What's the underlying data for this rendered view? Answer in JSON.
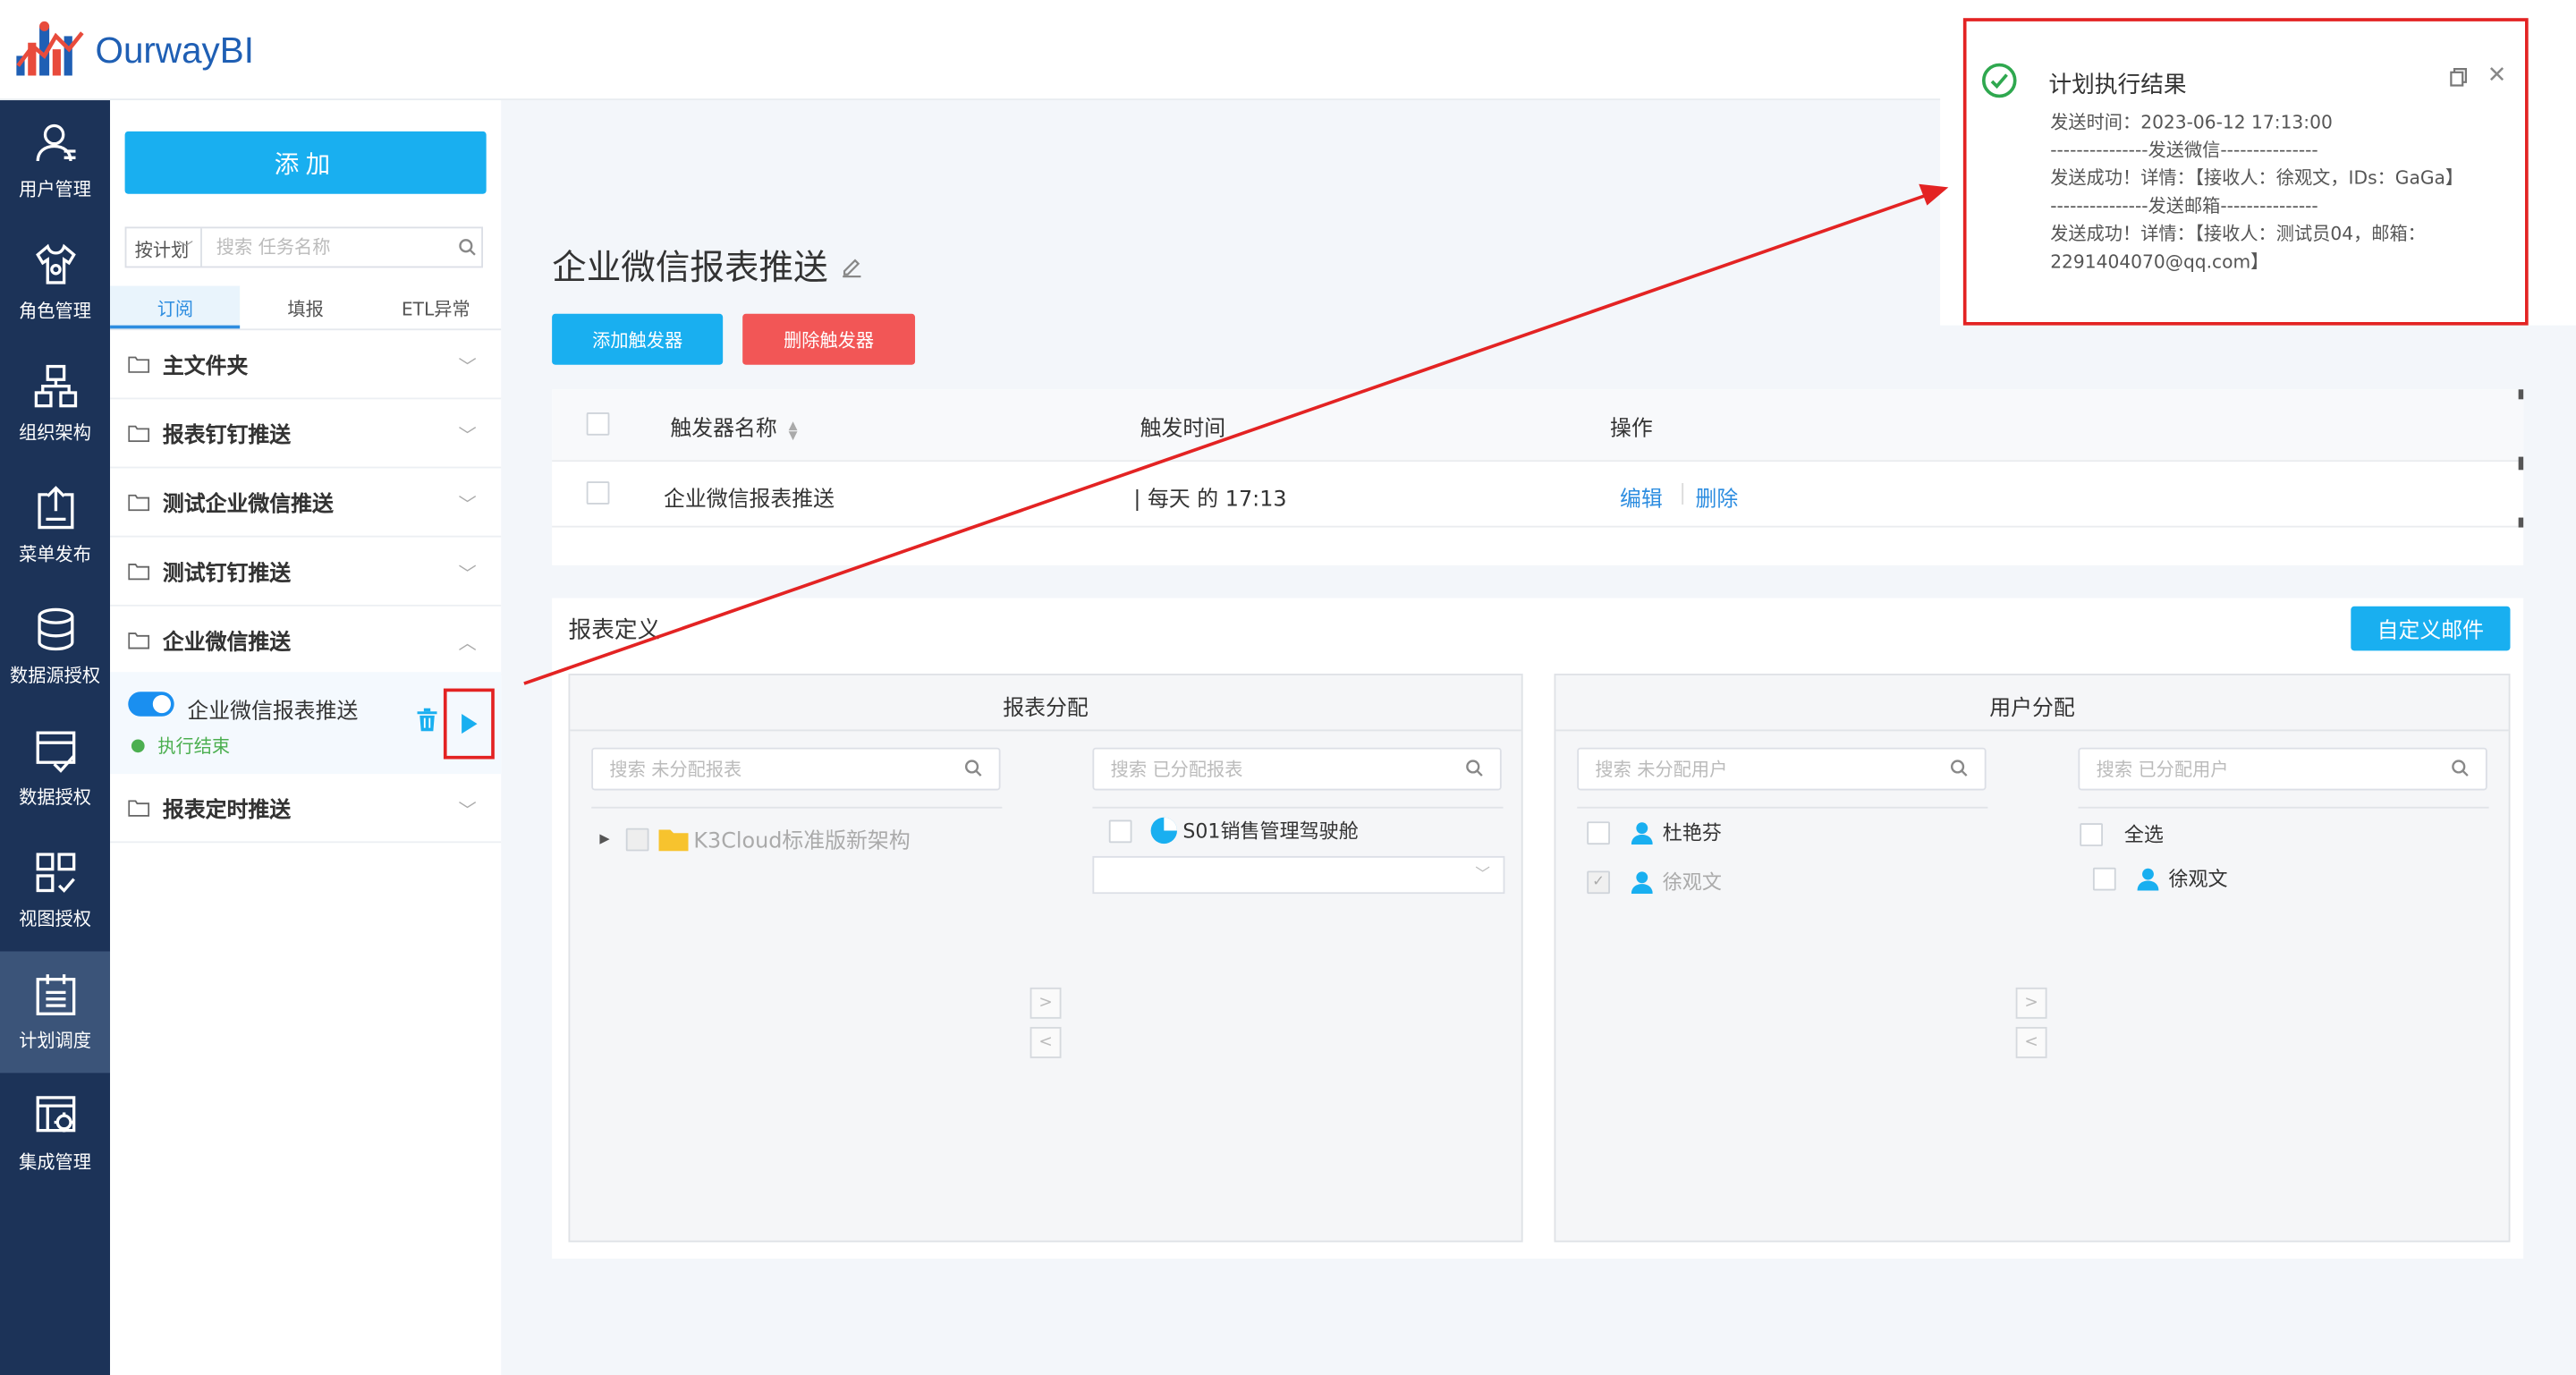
{
  "app": {
    "logo_text": "OurwayBI"
  },
  "nav": {
    "items": [
      {
        "label": "用户管理",
        "icon": "user-icon"
      },
      {
        "label": "角色管理",
        "icon": "role-shirt-icon"
      },
      {
        "label": "组织架构",
        "icon": "org-chart-icon"
      },
      {
        "label": "菜单发布",
        "icon": "publish-icon"
      },
      {
        "label": "数据源授权",
        "icon": "database-icon"
      },
      {
        "label": "数据授权",
        "icon": "data-auth-icon"
      },
      {
        "label": "视图授权",
        "icon": "view-grid-icon"
      },
      {
        "label": "计划调度",
        "icon": "calendar-icon",
        "active": true
      },
      {
        "label": "集成管理",
        "icon": "integration-icon"
      }
    ]
  },
  "sidebar": {
    "add_label": "添加",
    "filter_select": "按计划",
    "search_placeholder": "搜索 任务名称",
    "tabs": [
      "订阅",
      "填报",
      "ETL异常"
    ],
    "active_tab": "订阅",
    "folders": [
      {
        "label": "主文件夹",
        "expanded": false
      },
      {
        "label": "报表钉钉推送",
        "expanded": false
      },
      {
        "label": "测试企业微信推送",
        "expanded": false
      },
      {
        "label": "测试钉钉推送",
        "expanded": false
      },
      {
        "label": "企业微信推送",
        "expanded": true
      },
      {
        "label": "报表定时推送",
        "expanded": false
      }
    ],
    "task": {
      "name": "企业微信报表推送",
      "status": "执行结束",
      "enabled": true
    }
  },
  "main": {
    "title": "企业微信报表推送",
    "add_trigger_label": "添加触发器",
    "delete_trigger_label": "删除触发器",
    "table": {
      "headers": [
        "触发器名称",
        "触发时间",
        "操作"
      ],
      "rows": [
        {
          "name": "企业微信报表推送",
          "time": "| 每天 的 17:13",
          "edit": "编辑",
          "delete": "删除"
        }
      ]
    },
    "report_def": {
      "title": "报表定义",
      "custom_mail_label": "自定义邮件",
      "report_box": {
        "title": "报表分配",
        "left_placeholder": "搜索 未分配报表",
        "right_placeholder": "搜索 已分配报表",
        "left_items": [
          "K3Cloud标准版新架构"
        ],
        "right_items": [
          "S01销售管理驾驶舱"
        ]
      },
      "user_box": {
        "title": "用户分配",
        "left_placeholder": "搜索 未分配用户",
        "right_placeholder": "搜索 已分配用户",
        "left_items": [
          "杜艳芬",
          "徐观文"
        ],
        "select_all": "全选",
        "right_items": [
          "徐观文"
        ]
      }
    }
  },
  "notification": {
    "title": "计划执行结果",
    "lines": [
      "发送时间：2023-06-12 17:13:00",
      "---------------发送微信---------------",
      "发送成功！详情：【接收人：徐观文，IDs：GaGa】",
      "---------------发送邮箱---------------",
      "发送成功！详情：【接收人：测试员04，邮箱：",
      "2291404070@qq.com】"
    ]
  },
  "colors": {
    "accent": "#19aff0",
    "danger": "#f25656",
    "nav_bg": "#1c3358",
    "annotation": "#e32323"
  }
}
